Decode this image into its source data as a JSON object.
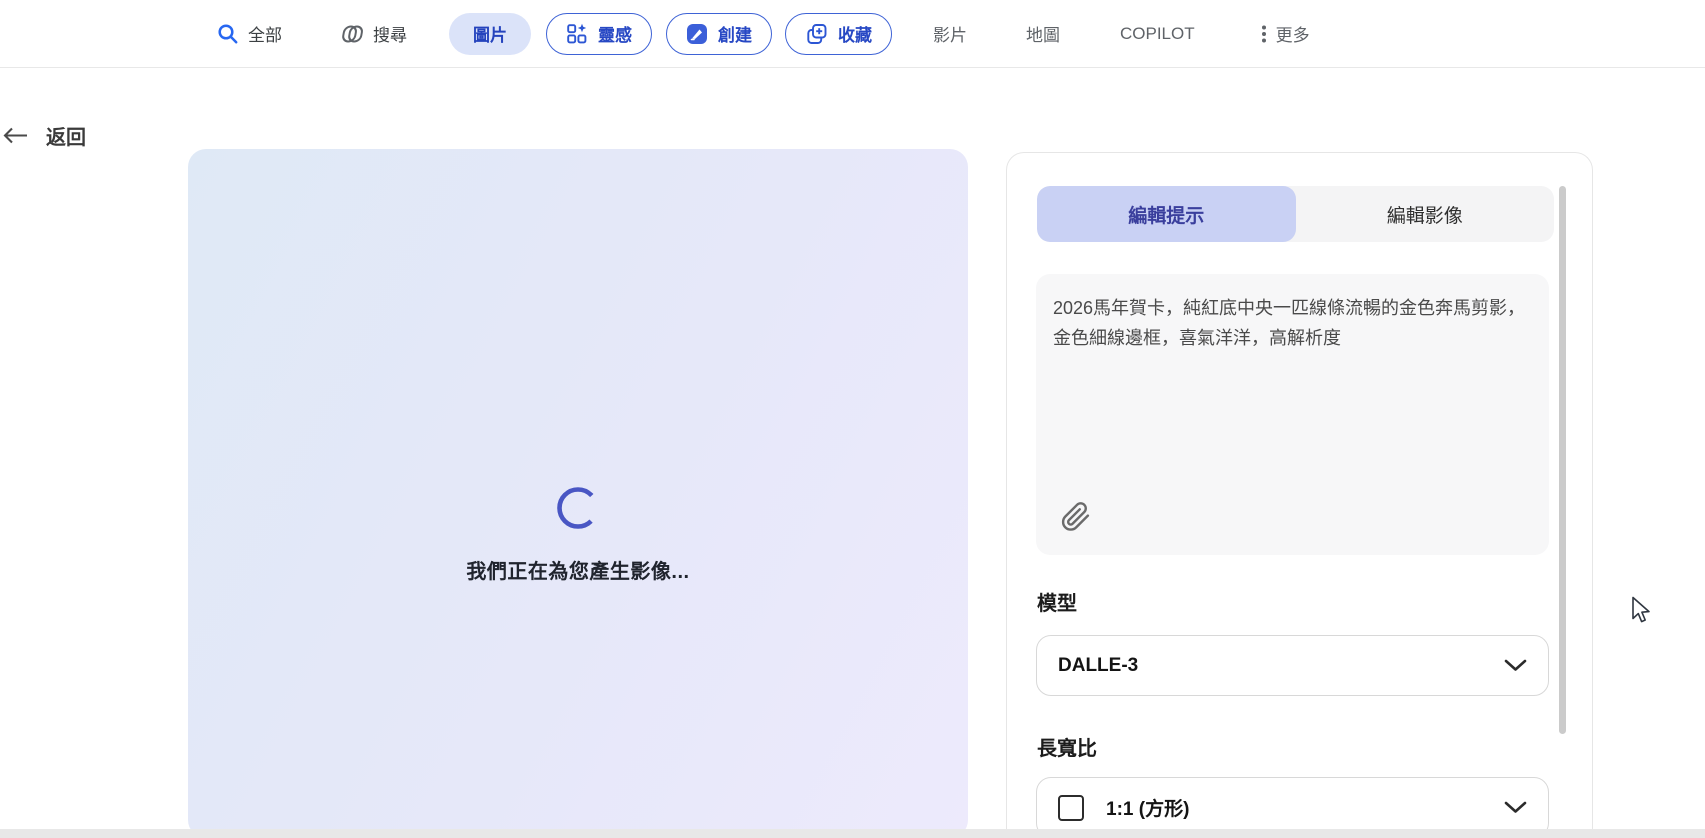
{
  "nav": {
    "items": [
      {
        "label": "全部"
      },
      {
        "label": "搜尋"
      },
      {
        "label": "圖片"
      },
      {
        "label": "靈感"
      },
      {
        "label": "創建"
      },
      {
        "label": "收藏"
      },
      {
        "label": "影片"
      },
      {
        "label": "地圖"
      },
      {
        "label": "COPILOT"
      },
      {
        "label": "更多"
      }
    ]
  },
  "back_label": "返回",
  "canvas": {
    "loading_text": "我們正在為您產生影像..."
  },
  "editor": {
    "tab_edit_prompt": "編輯提示",
    "tab_edit_image": "編輯影像",
    "prompt_text": "2026馬年賀卡，純紅底中央一匹線條流暢的金色奔馬剪影，金色細線邊框，喜氣洋洋，高解析度",
    "model_label": "模型",
    "model_value": "DALLE-3",
    "aspect_label": "長寬比",
    "aspect_value": "1:1 (方形)"
  },
  "colors": {
    "accent_blue": "#2b52c8",
    "nav_pill_fill": "#dbe3f9",
    "tab_selected_bg": "#c9d1f4",
    "tab_selected_text": "#3a3f9d",
    "spinner": "#4956c4",
    "canvas_gradient_start": "#dfe9f6",
    "canvas_gradient_end": "#edeafc"
  }
}
